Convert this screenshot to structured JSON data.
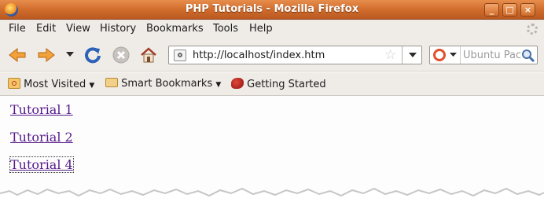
{
  "window": {
    "title": "PHP Tutorials - Mozilla Firefox",
    "controls": {
      "minimize": "_",
      "maximize": "□",
      "close": "×"
    }
  },
  "menu": [
    "File",
    "Edit",
    "View",
    "History",
    "Bookmarks",
    "Tools",
    "Help"
  ],
  "toolbar": {
    "icons": [
      "back-arrow-icon",
      "forward-arrow-icon",
      "history-dropdown-icon",
      "reload-icon",
      "stop-icon",
      "home-icon"
    ],
    "url": "http://localhost/index.htm",
    "search_placeholder": "Ubuntu Pac"
  },
  "bookmarks": {
    "items": [
      "Most Visited",
      "Smart Bookmarks",
      "Getting Started"
    ]
  },
  "content": {
    "links": [
      "Tutorial 1",
      "Tutorial 2",
      "Tutorial 4"
    ]
  },
  "colors": {
    "titlebar": "#cf6a2a",
    "chrome": "#efebe7",
    "visited_link": "#551a8b"
  }
}
